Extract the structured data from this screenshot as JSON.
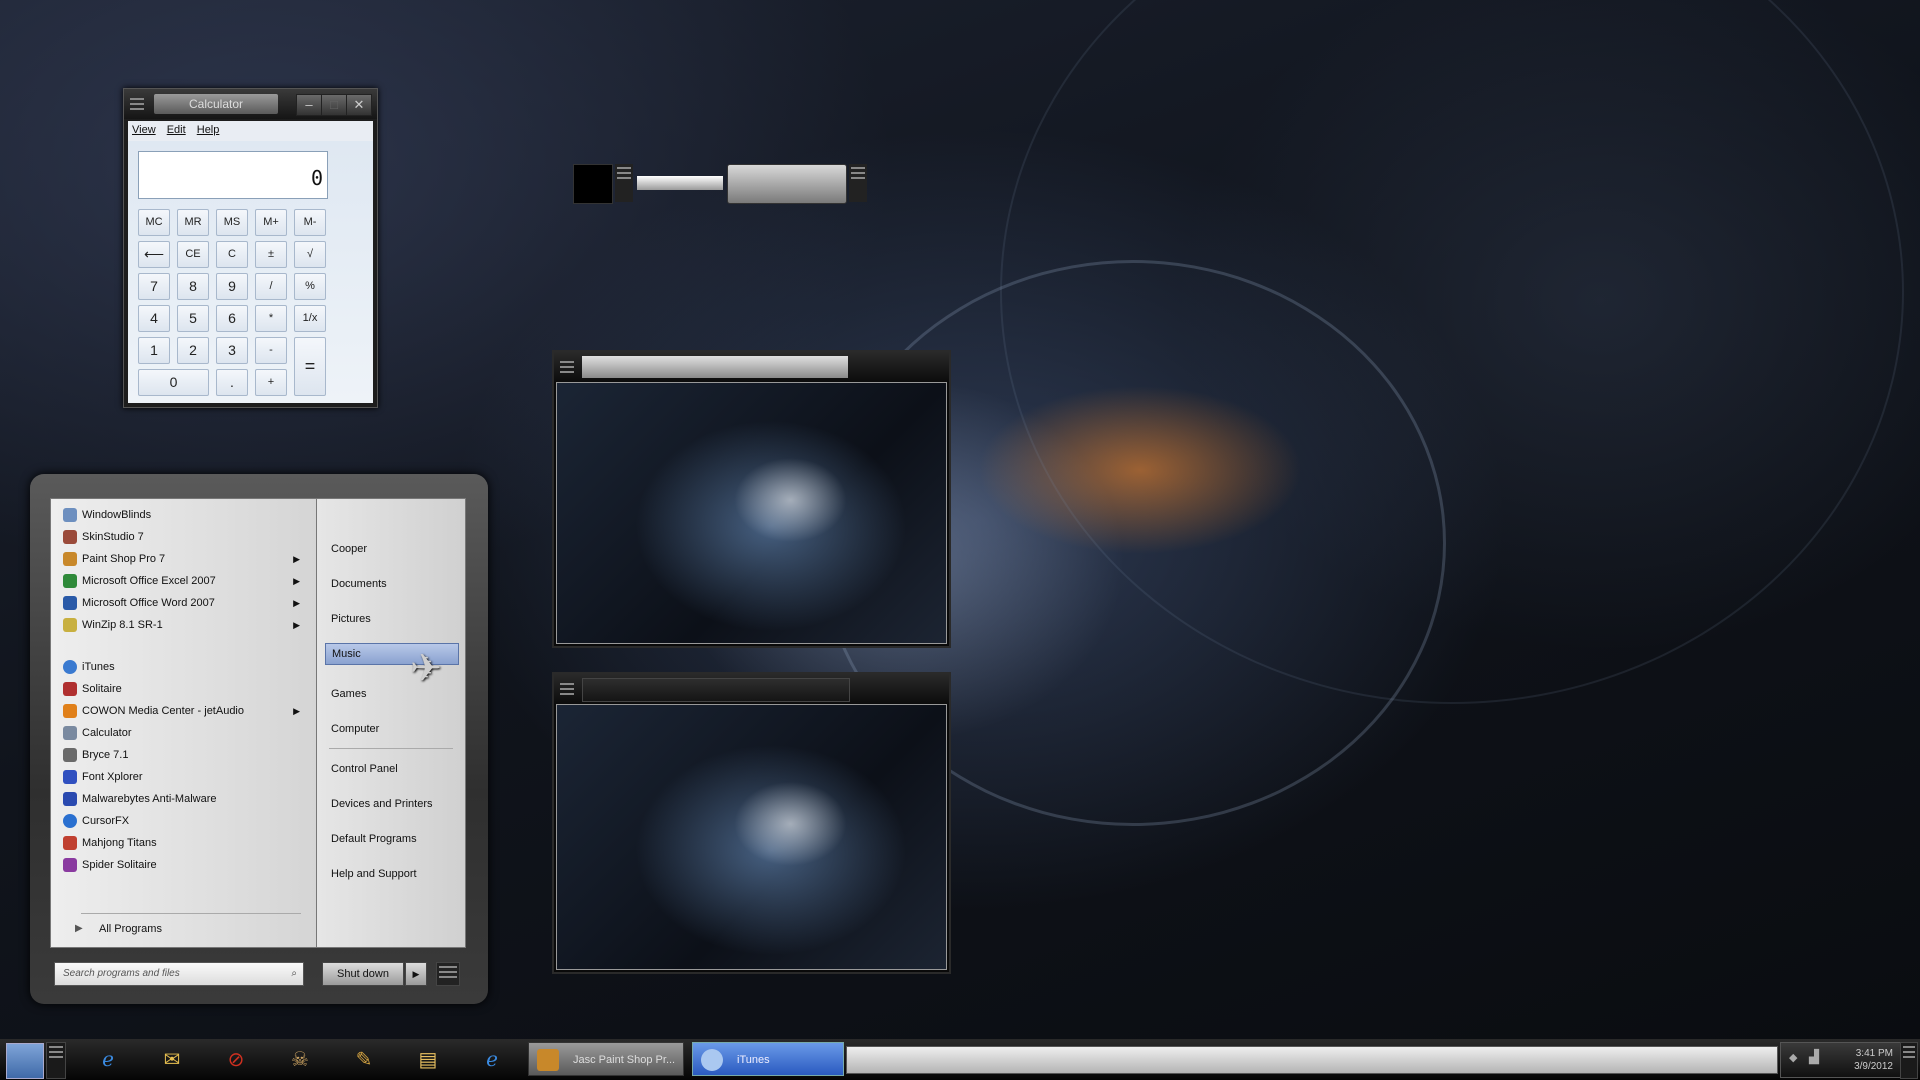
{
  "calculator": {
    "title": "Calculator",
    "menu": [
      "View",
      "Edit",
      "Help"
    ],
    "display": "0",
    "keys": {
      "mc": "MC",
      "mr": "MR",
      "ms": "MS",
      "mplus": "M+",
      "mminus": "M-",
      "back": "⟵",
      "ce": "CE",
      "c": "C",
      "plusminus": "±",
      "sqrt": "√",
      "k7": "7",
      "k8": "8",
      "k9": "9",
      "div": "/",
      "pct": "%",
      "k4": "4",
      "k5": "5",
      "k6": "6",
      "mul": "*",
      "recip": "1/x",
      "k1": "1",
      "k2": "2",
      "k3": "3",
      "sub": "-",
      "eq": "=",
      "k0": "0",
      "dot": ".",
      "add": "+"
    }
  },
  "start_menu": {
    "pinned": [
      {
        "label": "WindowBlinds",
        "icon": "windowblinds-icon",
        "color": "#6d8fbf",
        "submenu": false
      },
      {
        "label": "SkinStudio 7",
        "icon": "skinstudio-icon",
        "color": "#9a4a3a",
        "submenu": false
      },
      {
        "label": "Paint Shop Pro 7",
        "icon": "paintshop-icon",
        "color": "#c8882a",
        "submenu": true
      },
      {
        "label": "Microsoft Office Excel 2007",
        "icon": "excel-icon",
        "color": "#2f8a3a",
        "submenu": true
      },
      {
        "label": "Microsoft Office Word 2007",
        "icon": "word-icon",
        "color": "#2a5aa8",
        "submenu": true
      },
      {
        "label": "WinZip 8.1 SR-1",
        "icon": "winzip-icon",
        "color": "#c8b040",
        "submenu": true
      }
    ],
    "recent": [
      {
        "label": "iTunes",
        "icon": "itunes-icon",
        "color": "#3a7ad0",
        "submenu": false
      },
      {
        "label": "Solitaire",
        "icon": "solitaire-icon",
        "color": "#b03030",
        "submenu": false
      },
      {
        "label": "COWON Media Center - jetAudio",
        "icon": "jetaudio-icon",
        "color": "#e0801a",
        "submenu": true
      },
      {
        "label": "Calculator",
        "icon": "calculator-icon",
        "color": "#7a8aa0",
        "submenu": false
      },
      {
        "label": "Bryce 7.1",
        "icon": "bryce-icon",
        "color": "#6a6a6a",
        "submenu": false
      },
      {
        "label": "Font Xplorer",
        "icon": "font-icon",
        "color": "#3050c0",
        "submenu": false
      },
      {
        "label": "Malwarebytes Anti-Malware",
        "icon": "malwarebytes-icon",
        "color": "#2a4ab0",
        "submenu": false
      },
      {
        "label": "CursorFX",
        "icon": "cursorfx-icon",
        "color": "#2a70d0",
        "submenu": false
      },
      {
        "label": "Mahjong Titans",
        "icon": "mahjong-icon",
        "color": "#c04030",
        "submenu": false
      },
      {
        "label": "Spider Solitaire",
        "icon": "spider-icon",
        "color": "#8a3aa0",
        "submenu": false
      }
    ],
    "all_programs": "All Programs",
    "places": [
      "Cooper",
      "Documents",
      "Pictures",
      "Music",
      "Games",
      "Computer",
      "Control Panel",
      "Devices and Printers",
      "Default Programs",
      "Help and Support"
    ],
    "selected_place": "Music",
    "search_placeholder": "Search programs and files",
    "shutdown_label": "Shut down"
  },
  "taskbar": {
    "pinned": [
      "internet-explorer-icon",
      "outlook-icon",
      "no-entry-icon",
      "pirate-game-icon",
      "paint-shop-icon",
      "folder-icon",
      "internet-explorer-icon"
    ],
    "tasks": [
      {
        "label": "Jasc Paint Shop Pr...",
        "icon": "paintshop-icon",
        "active": false
      },
      {
        "label": "iTunes",
        "icon": "itunes-icon",
        "active": true
      }
    ],
    "clock_time": "3:41 PM",
    "clock_date": "3/9/2012"
  }
}
